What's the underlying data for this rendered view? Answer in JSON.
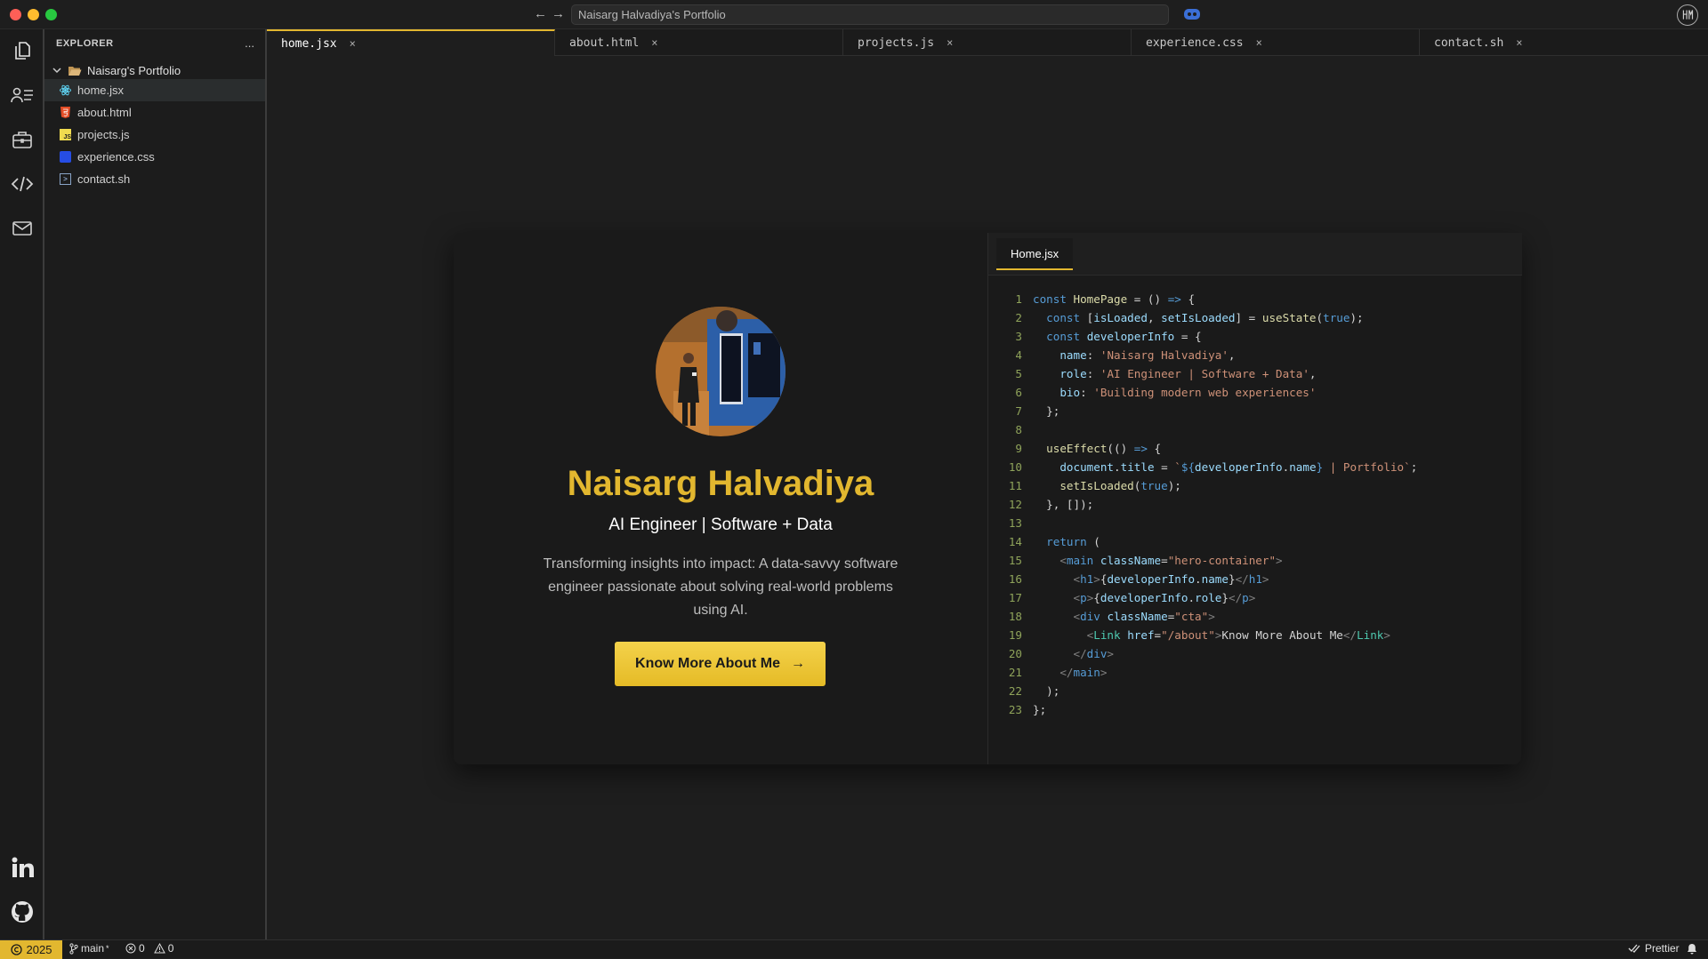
{
  "window": {
    "title": "Naisarg Halvadiya's Portfolio"
  },
  "activity_bar": {
    "icons": [
      "files-icon",
      "profile-icon",
      "briefcase-icon",
      "code-icon",
      "mail-icon",
      "linkedin-icon",
      "github-icon"
    ]
  },
  "explorer": {
    "heading": "EXPLORER",
    "more": "...",
    "folder": "Naisarg's Portfolio",
    "files": [
      {
        "label": "home.jsx",
        "icon": "react-icon",
        "color": "#61dafb"
      },
      {
        "label": "about.html",
        "icon": "html-icon",
        "color": "#e44d26"
      },
      {
        "label": "projects.js",
        "icon": "js-icon",
        "color": "#f0db4f"
      },
      {
        "label": "experience.css",
        "icon": "css-icon",
        "color": "#264de4"
      },
      {
        "label": "contact.sh",
        "icon": "shell-icon",
        "color": "#89a4c7"
      }
    ]
  },
  "tabs": [
    {
      "label": "home.jsx",
      "close": "×"
    },
    {
      "label": "about.html",
      "close": "×"
    },
    {
      "label": "projects.js",
      "close": "×"
    },
    {
      "label": "experience.css",
      "close": "×"
    },
    {
      "label": "contact.sh",
      "close": "×"
    }
  ],
  "hero": {
    "name": "Naisarg Halvadiya",
    "role": "AI Engineer | Software + Data",
    "bio": "Transforming insights into impact: A data-savvy software engineer passionate about solving real-world problems using AI.",
    "cta_label": "Know More About Me",
    "cta_arrow": "→"
  },
  "code_panel": {
    "tab": "Home.jsx",
    "line_numbers": [
      "1",
      "2",
      "3",
      "4",
      "5",
      "6",
      "7",
      "8",
      "9",
      "10",
      "11",
      "12",
      "13",
      "14",
      "15",
      "16",
      "17",
      "18",
      "19",
      "20",
      "21",
      "22",
      "23"
    ]
  },
  "statusbar": {
    "year": "2025",
    "branch": "main",
    "errors": "0",
    "warnings": "0",
    "formatter": "Prettier"
  },
  "colors": {
    "accent": "#e2b72f",
    "background": "#1e1e1e"
  }
}
